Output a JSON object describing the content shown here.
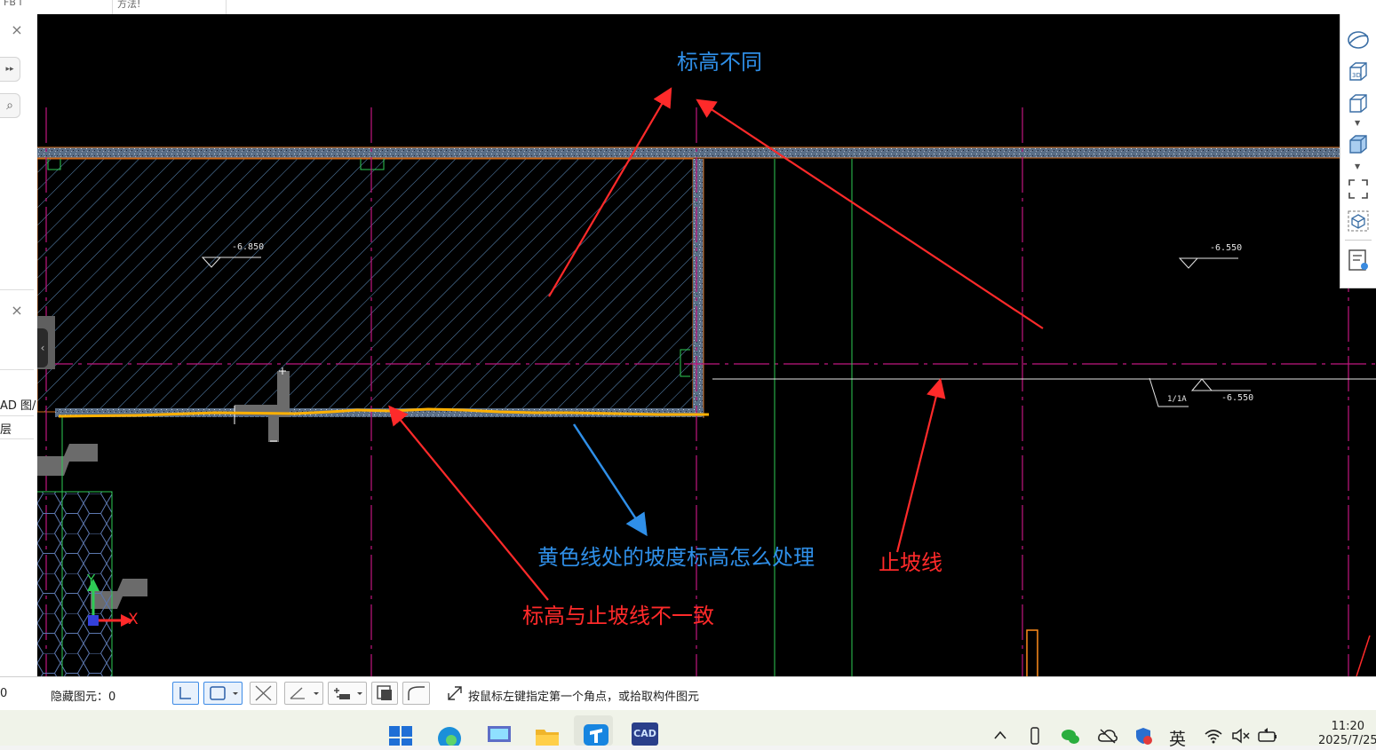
{
  "top": {
    "cell1": "FB I",
    "cell2": "方法!"
  },
  "left_panel": {
    "close": "×",
    "expand": "▸▸",
    "search": "⌕",
    "row1": "AD 图/",
    "row2": "层",
    "collapse": "‹"
  },
  "canvas": {
    "levels": {
      "left": "-6.850",
      "right_upper": "-6.550",
      "right_lower": "-6.550",
      "bracket_tag": "1/1A"
    },
    "annotations": {
      "elevation_diff": "标高不同",
      "slope_question": "黄色线处的坡度标高怎么处理",
      "stop_slope_line": "止坡线",
      "mismatch": "标高与止坡线不一致"
    },
    "axes": {
      "x": "X",
      "y": "Y"
    }
  },
  "right_toolbar": {
    "three_d_label": "3D"
  },
  "status": {
    "left_num": "0",
    "hidden_label": "隐藏图元：0",
    "hint": "按鼠标左键指定第一个角点，或拾取构件图元"
  },
  "taskbar": {
    "cad_label": "CAD",
    "ime": "英",
    "time": "11:20",
    "date": "2025/7/25"
  },
  "colors": {
    "canvas_bg": "#000000",
    "annotation_blue": "#2f8fe8",
    "annotation_red": "#ff2a2a",
    "yellow_line": "#ffb000",
    "magenta_axis": "#c0167f"
  }
}
